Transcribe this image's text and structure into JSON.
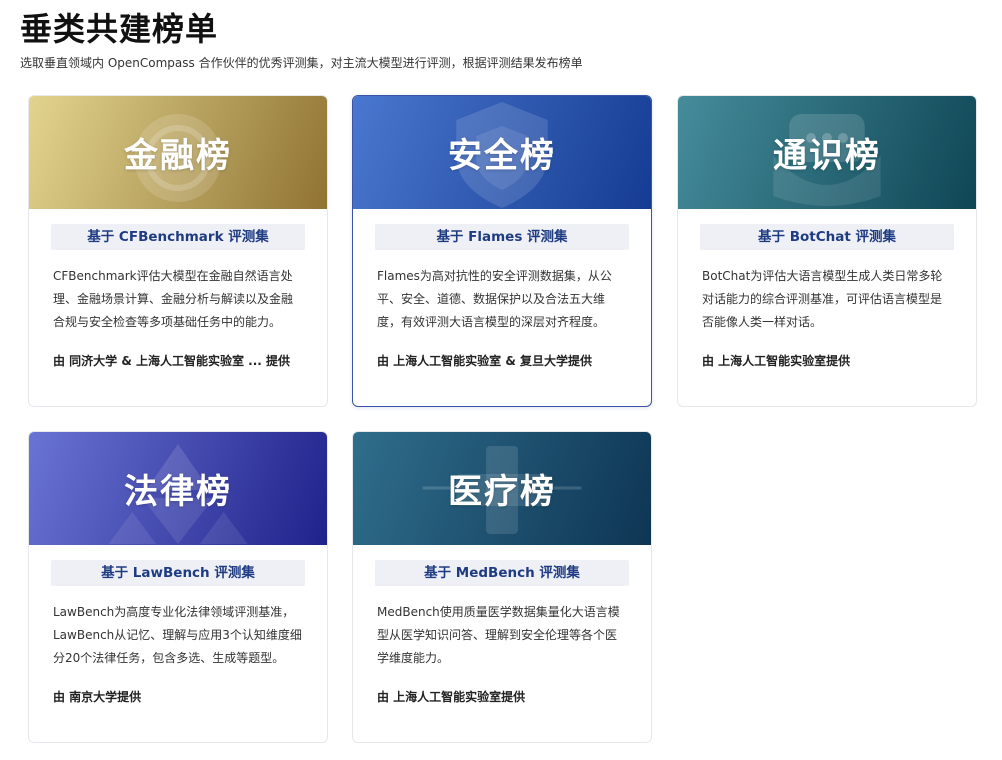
{
  "page": {
    "title": "垂类共建榜单",
    "subtitle": "选取垂直领域内 OpenCompass 合作伙伴的优秀评测集，对主流大模型进行评测，根据评测结果发布榜单"
  },
  "cards": [
    {
      "title": "金融榜",
      "dataset": "基于 CFBenchmark 评测集",
      "description": "CFBenchmark评估大模型在金融自然语言处理、金融场景计算、金融分析与解读以及金融合规与安全检查等多项基础任务中的能力。",
      "provider": "由 同济大学 & 上海人工智能实验室 ... 提供",
      "colors": [
        "#e2d48f",
        "#907333"
      ]
    },
    {
      "title": "安全榜",
      "dataset": "基于 Flames 评测集",
      "description": "Flames为高对抗性的安全评测数据集，从公平、安全、道德、数据保护以及合法五大维度，有效评测大语言模型的深层对齐程度。",
      "provider": "由 上海人工智能实验室 & 复旦大学提供",
      "colors": [
        "#4a77cf",
        "#153c92"
      ]
    },
    {
      "title": "通识榜",
      "dataset": "基于 BotChat 评测集",
      "description": "BotChat为评估大语言模型生成人类日常多轮对话能力的综合评测基准，可评估语言模型是否能像人类一样对话。",
      "provider": "由 上海人工智能实验室提供",
      "colors": [
        "#458c9a",
        "#0f4656"
      ]
    },
    {
      "title": "法律榜",
      "dataset": "基于 LawBench 评测集",
      "description": "LawBench为高度专业化法律领域评测基准，LawBench从记忆、理解与应用3个认知维度细分20个法律任务，包含多选、生成等题型。",
      "provider": "由 南京大学提供",
      "colors": [
        "#6a74d4",
        "#1f228a"
      ]
    },
    {
      "title": "医疗榜",
      "dataset": "基于 MedBench 评测集",
      "description": "MedBench使用质量医学数据集量化大语言模型从医学知识问答、理解到安全伦理等各个医学维度能力。",
      "provider": "由 上海人工智能实验室提供",
      "colors": [
        "#2f6e8c",
        "#0e3554"
      ]
    }
  ]
}
